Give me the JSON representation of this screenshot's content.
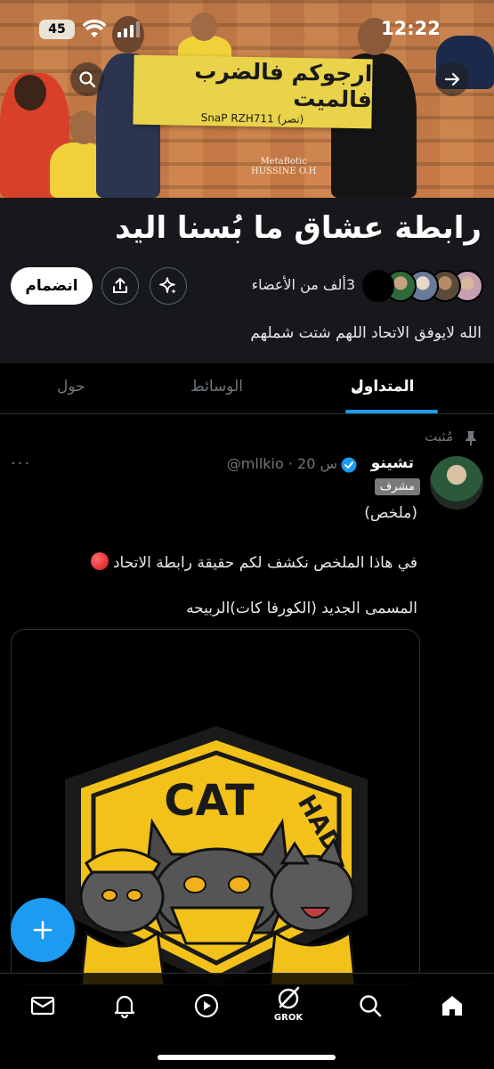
{
  "status_bar": {
    "battery": "45",
    "time": "12:22"
  },
  "banner": {
    "sign_line1": "ارجوكم فالضرب فالميت",
    "sign_line2": "SnaP RZH711 (نصر)",
    "watermark_line1": "MetaBotic",
    "watermark_line2": "HUSSINE O.H"
  },
  "community": {
    "title": "رابطة عشاق ما بُسنا اليد",
    "join_label": "انضمام",
    "members_text": "3ألف من الأعضاء",
    "description": "الله لايوفق الاتحاد اللهم شتت شملهم"
  },
  "tabs": [
    {
      "label": "المتداول",
      "active": true
    },
    {
      "label": "الوسائط",
      "active": false
    },
    {
      "label": "حول",
      "active": false
    }
  ],
  "post": {
    "pinned_label": "مُثبت",
    "author_name": "تشينو",
    "handle": "@mllkio · 20 س",
    "moderator_badge": "مشرف",
    "more": "···",
    "lines": [
      "(ملخص)",
      "في هاذا الملخص نكشف لكم حقيقة رابطة الاتحاد",
      "المسمى الجديد (الكورفا كات)الربيحه"
    ],
    "media_text": {
      "shield_cat": "CAT",
      "shield_had": "HAD"
    }
  },
  "nav": {
    "grok_label": "GROK"
  },
  "colors": {
    "accent": "#1d9bf0",
    "yellow": "#f2c21b",
    "background": "#000000"
  },
  "icons": [
    "search-icon",
    "forward-arrow-icon",
    "share-icon",
    "sparkle-icon",
    "pin-icon",
    "verified-icon",
    "plus-icon",
    "mail-icon",
    "bell-icon",
    "play-icon",
    "grok-icon",
    "home-icon"
  ]
}
